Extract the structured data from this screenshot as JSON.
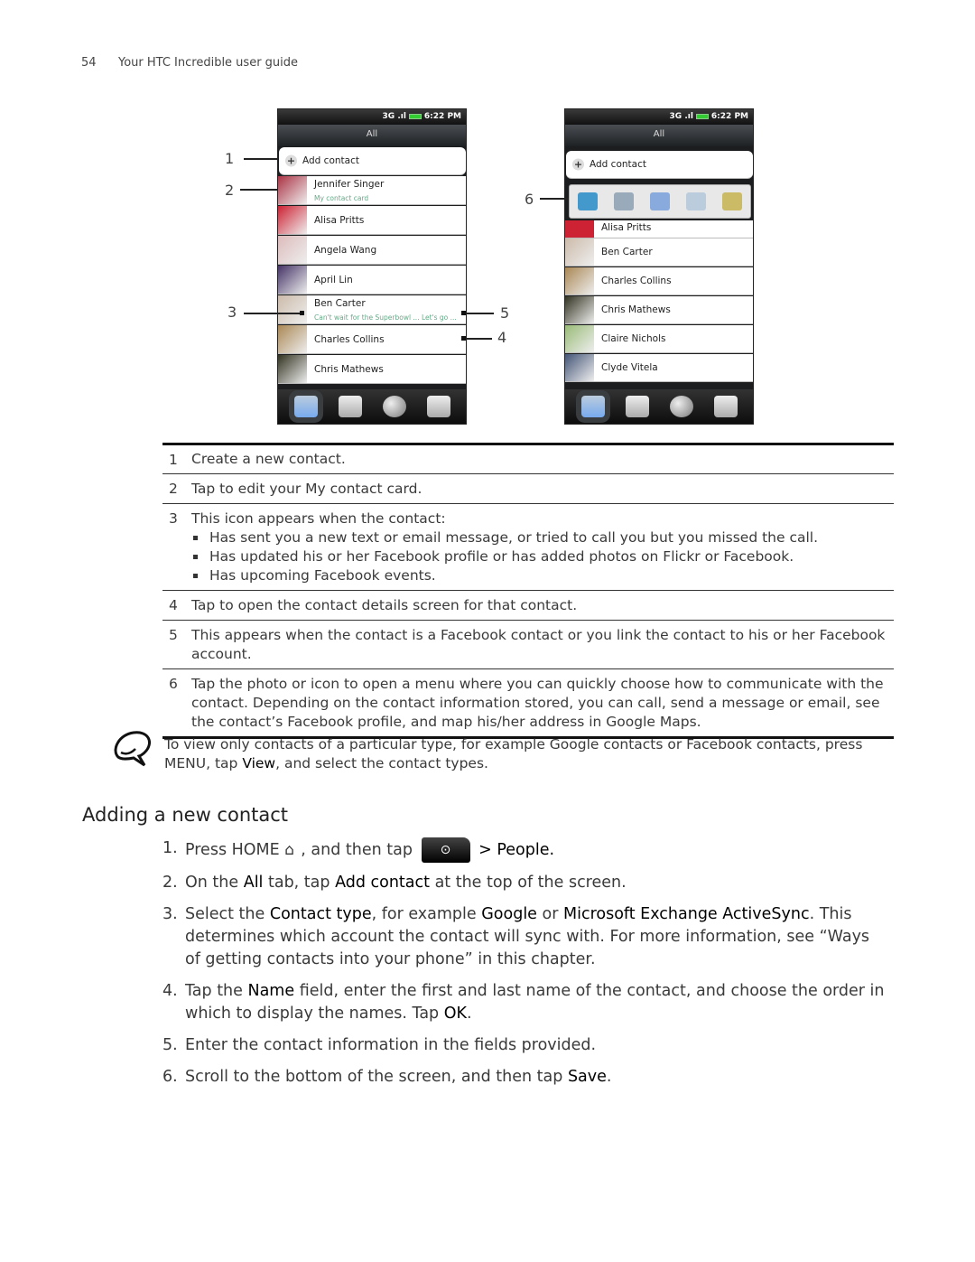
{
  "header": {
    "page_number": "54",
    "title": "Your HTC Incredible user guide"
  },
  "phone_common": {
    "time": "6:22 PM",
    "network": "3G",
    "tab": "All",
    "add_contact": "Add contact"
  },
  "phone1": {
    "contacts": [
      {
        "name": "Jennifer Singer",
        "sub": "My contact card",
        "color": "#a34"
      },
      {
        "name": "Alisa Pritts",
        "color": "#c23"
      },
      {
        "name": "Angela Wang",
        "color": "#dbb"
      },
      {
        "name": "April  Lin",
        "color": "#436"
      },
      {
        "name": "Ben  Carter",
        "sub": "Can't wait for the Superbowl ... Let's go ...",
        "color": "#cba"
      },
      {
        "name": "Charles  Collins",
        "color": "#a85"
      },
      {
        "name": "Chris Mathews",
        "color": "#332"
      }
    ]
  },
  "phone2": {
    "partial_contact": "Alisa Pritts",
    "contacts": [
      {
        "name": "Ben  Carter",
        "color": "#cba"
      },
      {
        "name": "Charles  Collins",
        "color": "#a85"
      },
      {
        "name": "Chris Mathews",
        "color": "#332"
      },
      {
        "name": "Claire Nichols",
        "color": "#9b7"
      },
      {
        "name": "Clyde Vitela",
        "color": "#457"
      }
    ],
    "quick_icons": [
      "phone-icon",
      "facebook-icon",
      "message-icon",
      "email-icon",
      "map-icon"
    ]
  },
  "callouts": [
    "1",
    "2",
    "3",
    "4",
    "5",
    "6"
  ],
  "legend": [
    {
      "n": "1",
      "text": "Create a new contact."
    },
    {
      "n": "2",
      "text": "Tap to edit your My contact card."
    },
    {
      "n": "3",
      "text": "This icon appears when the contact:",
      "bullets": [
        "Has sent you a new text or email message, or tried to call you but you missed the call.",
        "Has updated his or her Facebook profile or has added photos on Flickr or Facebook.",
        "Has upcoming Facebook events."
      ]
    },
    {
      "n": "4",
      "text": "Tap to open the contact details screen for that contact."
    },
    {
      "n": "5",
      "text": "This appears when the contact is a Facebook contact or you link the contact to his or her Facebook account."
    },
    {
      "n": "6",
      "text": "Tap the photo or icon to open a menu where you can quickly choose how to communicate with the contact. Depending on the contact information stored, you can call, send a message or email, see the contact’s Facebook profile, and map his/her address in Google Maps."
    }
  ],
  "note": {
    "a": "To view only contacts of a particular type, for example Google contacts or Facebook contacts, press MENU, tap ",
    "b": "View",
    "c": ", and select the contact types."
  },
  "section_title": "Adding a new contact",
  "steps": {
    "s1": {
      "n": "1.",
      "a": "Press HOME ",
      "b": ", and then tap ",
      "c": " > People."
    },
    "s2": {
      "n": "2.",
      "a": "On the ",
      "b": "All",
      "c": " tab, tap ",
      "d": "Add contact",
      "e": " at the top of the screen."
    },
    "s3": {
      "n": "3.",
      "a": "Select the ",
      "b": "Contact type",
      "c": ", for example ",
      "d": "Google",
      "e": " or ",
      "f": "Microsoft Exchange ActiveSync",
      "g": ". This determines which account the contact will sync with. For more information, see “Ways of getting contacts into your phone” in this chapter."
    },
    "s4": {
      "n": "4.",
      "a": "Tap the ",
      "b": "Name",
      "c": " field, enter the first and last name of the contact, and choose the order in which to display the names. Tap ",
      "d": "OK",
      "e": "."
    },
    "s5": {
      "n": "5.",
      "a": "Enter the contact information in the fields provided."
    },
    "s6": {
      "n": "6.",
      "a": "Scroll to the bottom of the screen, and then tap ",
      "b": "Save",
      "c": "."
    }
  }
}
